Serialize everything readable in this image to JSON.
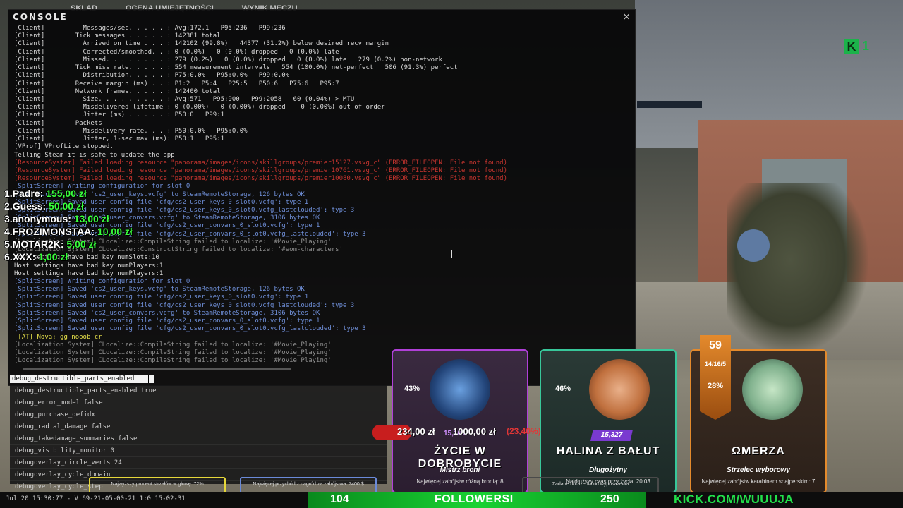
{
  "background": {
    "tabs": [
      "SKLAD",
      "OCENA UMIEJĘTNOŚCI",
      "WYNIK MECZU"
    ],
    "kick_logo": "K",
    "kick_count": "1"
  },
  "console": {
    "title": "CONSOLE",
    "close_glyph": "×",
    "input_value": "debug_destructible_parts_enabled",
    "log": [
      {
        "c": "white",
        "t": "[Client]          Messages/sec. . . . . : Avg:172.1   P95:236   P99:236"
      },
      {
        "c": "white",
        "t": "[Client]        Tick messages . . . . . : 142381 total"
      },
      {
        "c": "white",
        "t": "[Client]          Arrived on time . . . : 142102 (99.8%)   44377 (31.2%) below desired recv margin"
      },
      {
        "c": "white",
        "t": "[Client]          Corrected/smoothed. . : 0 (0.0%)   0 (0.0%) dropped   0 (0.0%) late"
      },
      {
        "c": "white",
        "t": "[Client]          Missed. . . . . . . . : 279 (0.2%)   0 (0.0%) dropped   0 (0.0%) late   279 (0.2%) non-network"
      },
      {
        "c": "white",
        "t": "[Client]        Tick miss rate. . . . . : 554 measurement intervals   554 (100.0%) net-perfect   506 (91.3%) perfect"
      },
      {
        "c": "white",
        "t": "[Client]          Distribution. . . . . : P75:0.0%   P95:0.0%   P99:0.0%"
      },
      {
        "c": "white",
        "t": "[Client]        Receive margin (ms) . . : P1:2   P5:4   P25:5   P50:6   P75:6   P95:7"
      },
      {
        "c": "white",
        "t": "[Client]        Network frames. . . . . : 142400 total"
      },
      {
        "c": "white",
        "t": "[Client]          Size. . . . . . . . . : Avg:571   P95:900   P99:2058   60 (0.04%) > MTU"
      },
      {
        "c": "white",
        "t": "[Client]          Misdelivered lifetime : 0 (0.00%)   0 (0.00%) dropped    0 (0.00%) out of order"
      },
      {
        "c": "white",
        "t": "[Client]          Jitter (ms) . . . . . : P50:0   P99:1"
      },
      {
        "c": "white",
        "t": "[Client]        Packets"
      },
      {
        "c": "white",
        "t": "[Client]          Misdelivery rate. . . : P50:0.0%   P95:0.0%"
      },
      {
        "c": "white",
        "t": "[Client]          Jitter, 1-sec max (ms): P50:1   P95:1"
      },
      {
        "c": "white",
        "t": "[VProf] VProfLite stopped."
      },
      {
        "c": "white",
        "t": "Telling Steam it is safe to update the app"
      },
      {
        "c": "red",
        "t": "[ResourceSystem] Failed loading resource \"panorama/images/icons/skillgroups/premier15127.vsvg_c\" (ERROR_FILEOPEN: File not found)"
      },
      {
        "c": "red",
        "t": "[ResourceSystem] Failed loading resource \"panorama/images/icons/skillgroups/premier10761.vsvg_c\" (ERROR_FILEOPEN: File not found)"
      },
      {
        "c": "red",
        "t": "[ResourceSystem] Failed loading resource \"panorama/images/icons/skillgroups/premier10080.vsvg_c\" (ERROR_FILEOPEN: File not found)"
      },
      {
        "c": "blue",
        "t": "[SplitScreen] Writing configuration for slot 0"
      },
      {
        "c": "blue",
        "t": "[SplitScreen] Saved 'cs2_user_keys.vcfg' to SteamRemoteStorage, 126 bytes OK"
      },
      {
        "c": "blue",
        "t": "[SplitScreen] Saved user config file 'cfg/cs2_user_keys_0_slot0.vcfg': type 1"
      },
      {
        "c": "blue",
        "t": "[SplitScreen] Saved user config file 'cfg/cs2_user_keys_0_slot0.vcfg_lastclouded': type 3"
      },
      {
        "c": "blue",
        "t": "[SplitScreen] Saved 'cs2_user_convars.vcfg' to SteamRemoteStorage, 3106 bytes OK"
      },
      {
        "c": "blue",
        "t": "[SplitScreen] Saved user config file 'cfg/cs2_user_convars_0_slot0.vcfg': type 1"
      },
      {
        "c": "blue",
        "t": "[SplitScreen] Saved user config file 'cfg/cs2_user_convars_0_slot0.vcfg_lastclouded': type 3"
      },
      {
        "c": "gray",
        "t": "[Localization System] CLocalize::CompileString failed to localize: '#Movie_Playing'"
      },
      {
        "c": "gray",
        "t": "[Localization System] CLocalize::ConstructString failed to localize: '#eom-characters'"
      },
      {
        "c": "white",
        "t": "Host settings have bad key numSlots:10"
      },
      {
        "c": "white",
        "t": "Host settings have bad key numPlayers:1"
      },
      {
        "c": "white",
        "t": "Host settings have bad key numPlayers:1"
      },
      {
        "c": "blue",
        "t": "[SplitScreen] Writing configuration for slot 0"
      },
      {
        "c": "blue",
        "t": "[SplitScreen] Saved 'cs2_user_keys.vcfg' to SteamRemoteStorage, 126 bytes OK"
      },
      {
        "c": "blue",
        "t": "[SplitScreen] Saved user config file 'cfg/cs2_user_keys_0_slot0.vcfg': type 1"
      },
      {
        "c": "blue",
        "t": "[SplitScreen] Saved user config file 'cfg/cs2_user_keys_0_slot0.vcfg_lastclouded': type 3"
      },
      {
        "c": "blue",
        "t": "[SplitScreen] Saved 'cs2_user_convars.vcfg' to SteamRemoteStorage, 3106 bytes OK"
      },
      {
        "c": "blue",
        "t": "[SplitScreen] Saved user config file 'cfg/cs2_user_convars_0_slot0.vcfg': type 1"
      },
      {
        "c": "blue",
        "t": "[SplitScreen] Saved user config file 'cfg/cs2_user_convars_0_slot0.vcfg_lastclouded': type 3"
      },
      {
        "c": "yellow",
        "t": " [AT] Nova: gg nooob cr"
      },
      {
        "c": "gray",
        "t": "[Localization System] CLocalize::CompileString failed to localize: '#Movie_Playing'"
      },
      {
        "c": "gray",
        "t": "[Localization System] CLocalize::CompileString failed to localize: '#Movie_Playing'"
      },
      {
        "c": "gray",
        "t": "[Localization System] CLocalize::CompileString failed to localize: '#Movie_Playing'"
      }
    ],
    "autocomplete": [
      "debug_destructible_parts_enabled true",
      "debug_error_model false",
      "debug_purchase_defidx",
      "debug_radial_damage false",
      "debug_takedamage_summaries false",
      "debug_visibility_monitor 0",
      "debugoverlay_circle_verts 24",
      "debugoverlay_cycle_domain",
      "debugoverlay_cycle_step"
    ]
  },
  "donations": [
    {
      "rank": "1.",
      "name": "Padre:",
      "amount": "155,00 zł"
    },
    {
      "rank": "2.",
      "name": "Guess:",
      "amount": "50,00 zł"
    },
    {
      "rank": "3.",
      "name": "anonymous:",
      "amount": "13,00 zł"
    },
    {
      "rank": "4.",
      "name": "FROZIMONSTAA:",
      "amount": "10,00 zł"
    },
    {
      "rank": "5.",
      "name": "MOTAR2K:",
      "amount": "5,00 zł"
    },
    {
      "rank": "6.",
      "name": "XXX:",
      "amount": "1,00 zł"
    }
  ],
  "cards": [
    {
      "pct": "43%",
      "level": "15,300",
      "name": "ŻYCIE W DOBROBYCIE",
      "subtitle": "Mistrz broni",
      "desc": "Najwięcej zabójstw różną bronią: 8",
      "strip": "Najwyższy procent strzałów w głowę: 72%"
    },
    {
      "pct": "46%",
      "level": "15,327",
      "name": "HALINA Z BAŁUT",
      "subtitle": "Długożytny",
      "desc": "Najdłuższy czas przy życia: 20:03",
      "strip": "Najwięcej przychód z nagród za zabójstwa: 7400 $"
    },
    {
      "pct": "28%",
      "level": "59",
      "stats": "14/16/5",
      "name": "ΩMERZA",
      "subtitle": "Strzelec wyborowy",
      "desc": "Najwięcej zabójstw karabinem snajperskim: 7",
      "strip": "Zadane obrażenia od wyposażenia"
    }
  ],
  "money": {
    "current": "234,00 zł",
    "goal": "1000,00 zł",
    "pct": "(23,40%)"
  },
  "status_line": "Jul 20 15:30:77 - V 69-21-05-00-21 1:0 15-02-31",
  "followers": {
    "left": "104",
    "label": "FOLLOWERSI",
    "right": "250"
  },
  "kick_url": "KICK.COM/WUUUJA"
}
